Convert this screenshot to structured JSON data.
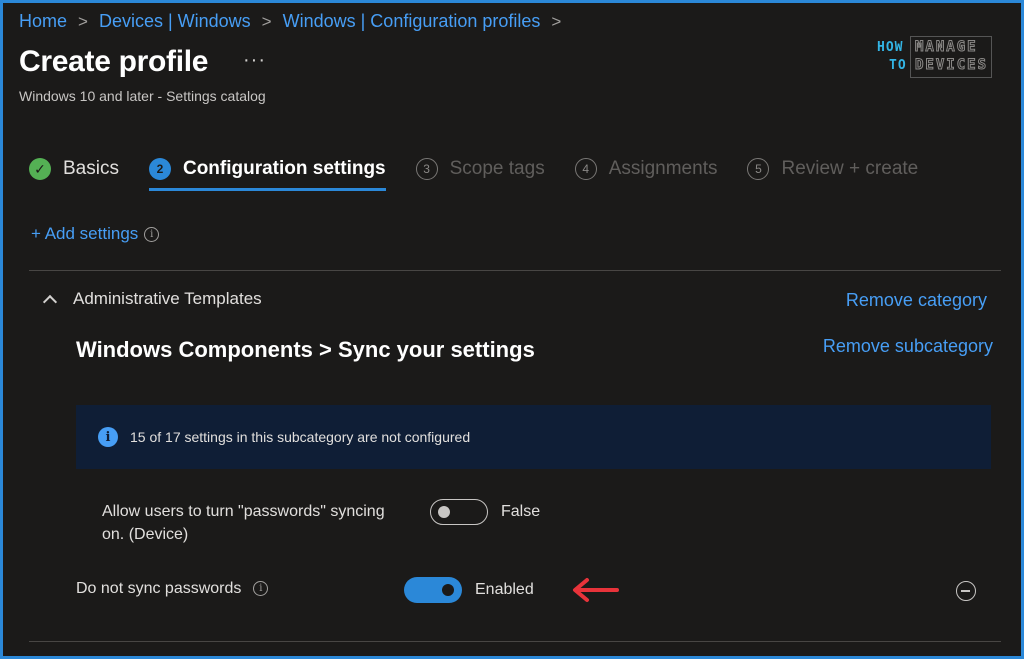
{
  "breadcrumb": [
    {
      "label": "Home"
    },
    {
      "label": "Devices | Windows"
    },
    {
      "label": "Windows | Configuration profiles"
    }
  ],
  "header": {
    "title": "Create profile",
    "more": "···",
    "subtitle": "Windows 10 and later - Settings catalog"
  },
  "logo": {
    "how": "HOW",
    "to": "TO",
    "manage": "MANAGE",
    "devices": "DEVICES"
  },
  "tabs": [
    {
      "num": "✓",
      "label": "Basics",
      "state": "done"
    },
    {
      "num": "2",
      "label": "Configuration settings",
      "state": "active"
    },
    {
      "num": "3",
      "label": "Scope tags",
      "state": "pending"
    },
    {
      "num": "4",
      "label": "Assignments",
      "state": "pending"
    },
    {
      "num": "5",
      "label": "Review + create",
      "state": "pending"
    }
  ],
  "add_settings": {
    "label": "+ Add settings",
    "info": "i"
  },
  "category": {
    "label": "Administrative Templates",
    "remove_label": "Remove category",
    "subcategory_title": "Windows Components > Sync your settings",
    "remove_sub_label": "Remove subcategory"
  },
  "banner": {
    "icon": "i",
    "text": "15 of 17 settings in this subcategory are not configured"
  },
  "settings": [
    {
      "label_line1": "Allow users to turn \"passwords\" syncing",
      "label_line2": "on. (Device)",
      "value": "False",
      "on": false
    },
    {
      "label": "Do not sync passwords",
      "info": "i",
      "value": "Enabled",
      "on": true
    }
  ],
  "colors": {
    "accent": "#2b88d8",
    "link": "#479ef5",
    "success": "#54b054",
    "annotation_arrow": "#e8333a"
  }
}
